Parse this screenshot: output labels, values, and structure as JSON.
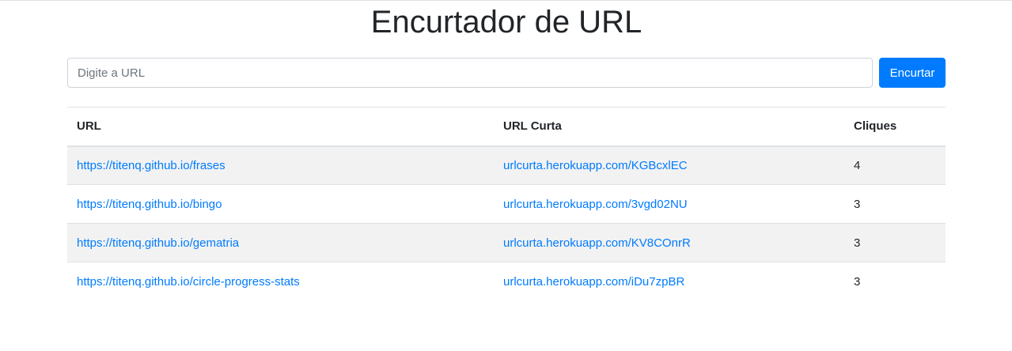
{
  "page": {
    "title": "Encurtador de URL"
  },
  "form": {
    "placeholder": "Digite a URL",
    "value": "",
    "button_label": "Encurtar"
  },
  "table": {
    "headers": {
      "url": "URL",
      "short_url": "URL Curta",
      "clicks": "Cliques"
    },
    "rows": [
      {
        "url": "https://titenq.github.io/frases",
        "short_url": "urlcurta.herokuapp.com/KGBcxlEC",
        "clicks": "4"
      },
      {
        "url": "https://titenq.github.io/bingo",
        "short_url": "urlcurta.herokuapp.com/3vgd02NU",
        "clicks": "3"
      },
      {
        "url": "https://titenq.github.io/gematria",
        "short_url": "urlcurta.herokuapp.com/KV8COnrR",
        "clicks": "3"
      },
      {
        "url": "https://titenq.github.io/circle-progress-stats",
        "short_url": "urlcurta.herokuapp.com/iDu7zpBR",
        "clicks": "3"
      }
    ]
  },
  "colors": {
    "link": "#007bff",
    "button": "#007bff",
    "stripe": "#f2f2f2",
    "border": "#dee2e6"
  }
}
